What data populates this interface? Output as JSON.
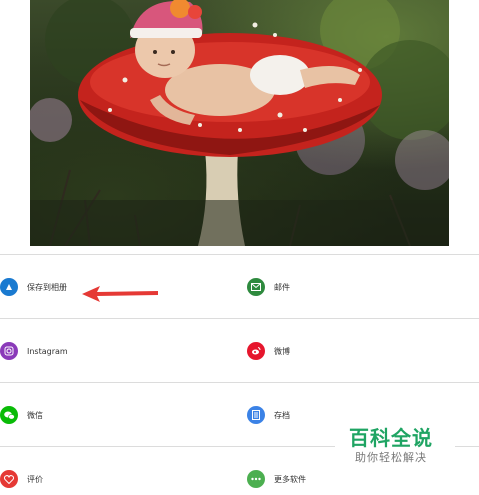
{
  "share_items": [
    {
      "label": "保存到相册",
      "icon": "save-to-album-icon",
      "color": "#1a7ad0"
    },
    {
      "label": "邮件",
      "icon": "mail-icon",
      "color": "#2e8a3e"
    },
    {
      "label": "Instagram",
      "icon": "instagram-icon",
      "color": "#8a3ab9"
    },
    {
      "label": "微博",
      "icon": "weibo-icon",
      "color": "#e6162d"
    },
    {
      "label": "微信",
      "icon": "wechat-icon",
      "color": "#09bb07"
    },
    {
      "label": "存档",
      "icon": "archive-icon",
      "color": "#3b82e6"
    },
    {
      "label": "评价",
      "icon": "heart-icon",
      "color": "#e53935"
    },
    {
      "label": "更多软件",
      "icon": "more-apps-icon",
      "color": "#4caf50"
    }
  ],
  "watermark": {
    "title": "百科全说",
    "subtitle": "助你轻松解决",
    "color": "#1fa463"
  },
  "annotation": {
    "arrow_color": "#e53935"
  }
}
